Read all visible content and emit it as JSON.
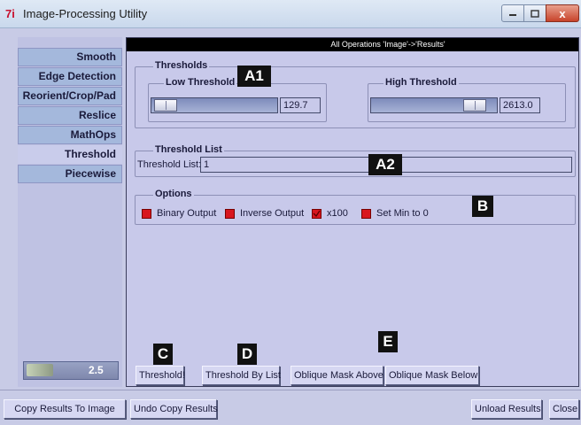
{
  "window": {
    "title": "Image-Processing Utility",
    "app_icon": "7i",
    "close_glyph": "x"
  },
  "sidebar": {
    "items": [
      {
        "label": "Smooth",
        "active": false
      },
      {
        "label": "Edge Detection",
        "active": false
      },
      {
        "label": "Reorient/Crop/Pad",
        "active": false
      },
      {
        "label": "Reslice",
        "active": false
      },
      {
        "label": "MathOps",
        "active": false
      },
      {
        "label": "Threshold",
        "active": true
      },
      {
        "label": "Piecewise",
        "active": false
      }
    ],
    "zoom_value": "2.5"
  },
  "ops_bar": {
    "label": "All Operations 'Image'->'Results'"
  },
  "thresholds": {
    "title": "Thresholds",
    "low": {
      "label": "Low Threshold",
      "value": "129.7",
      "position": 0.03
    },
    "high": {
      "label": "High Threshold",
      "value": "2613.0",
      "position": 0.9
    }
  },
  "threshold_list": {
    "title": "Threshold List",
    "label": "Threshold List:",
    "value": "1"
  },
  "options": {
    "title": "Options",
    "items": [
      {
        "label": "Binary Output",
        "checked": false
      },
      {
        "label": "Inverse Output",
        "checked": false
      },
      {
        "label": "x100",
        "checked": true
      },
      {
        "label": "Set Min to 0",
        "checked": false
      }
    ]
  },
  "actions": {
    "threshold": "Threshold!",
    "threshold_by_list": "Threshold By List",
    "oblique_above": "Oblique Mask Above",
    "oblique_below": "Oblique Mask Below"
  },
  "bottom": {
    "copy_results": "Copy Results To Image",
    "undo_copy": "Undo Copy Results",
    "unload_results": "Unload Results",
    "close": "Close"
  },
  "markers": {
    "a1": "A1",
    "a2": "A2",
    "b": "B",
    "c": "C",
    "d": "D",
    "e": "E"
  },
  "colors": {
    "accent_check": "#d8161e",
    "ops_bar_bg": "#000000",
    "sidebar_tab": "#a4b8dc"
  }
}
